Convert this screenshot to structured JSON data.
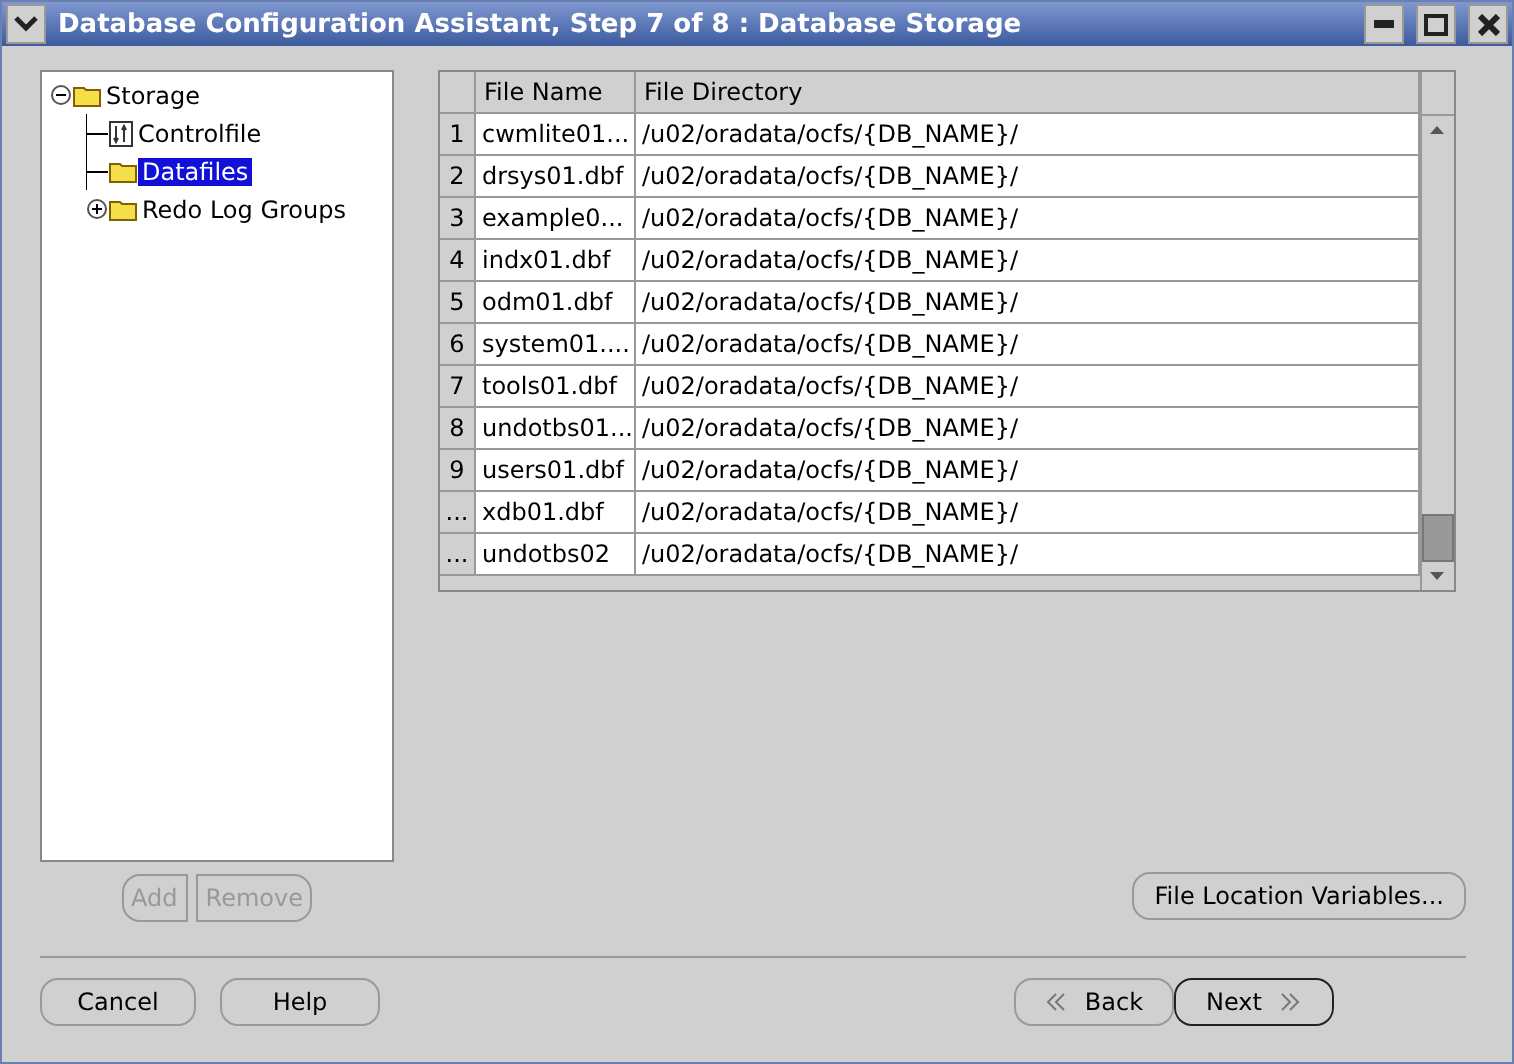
{
  "window": {
    "title": "Database Configuration Assistant, Step 7 of 8 : Database Storage"
  },
  "tree": [
    {
      "label": "Storage",
      "kind": "folder",
      "expanded": true,
      "selected": false,
      "children": [
        {
          "label": "Controlfile",
          "kind": "file",
          "selected": false
        },
        {
          "label": "Datafiles",
          "kind": "folder",
          "selected": true
        },
        {
          "label": "Redo Log Groups",
          "kind": "folder",
          "expanded": false,
          "selected": false
        }
      ]
    }
  ],
  "tree_buttons": [
    {
      "label": "Add",
      "disabled": true
    },
    {
      "label": "Remove",
      "disabled": true
    }
  ],
  "table": {
    "columns": [
      "File Name",
      "File Directory"
    ],
    "rows": [
      {
        "number": "1",
        "file_name": "cwmlite01...",
        "directory": "/u02/oradata/ocfs/{DB_NAME}/"
      },
      {
        "number": "2",
        "file_name": "drsys01.dbf",
        "directory": "/u02/oradata/ocfs/{DB_NAME}/"
      },
      {
        "number": "3",
        "file_name": "example0...",
        "directory": "/u02/oradata/ocfs/{DB_NAME}/"
      },
      {
        "number": "4",
        "file_name": "indx01.dbf",
        "directory": "/u02/oradata/ocfs/{DB_NAME}/"
      },
      {
        "number": "5",
        "file_name": "odm01.dbf",
        "directory": "/u02/oradata/ocfs/{DB_NAME}/"
      },
      {
        "number": "6",
        "file_name": "system01....",
        "directory": "/u02/oradata/ocfs/{DB_NAME}/"
      },
      {
        "number": "7",
        "file_name": "tools01.dbf",
        "directory": "/u02/oradata/ocfs/{DB_NAME}/"
      },
      {
        "number": "8",
        "file_name": "undotbs01...",
        "directory": "/u02/oradata/ocfs/{DB_NAME}/"
      },
      {
        "number": "9",
        "file_name": "users01.dbf",
        "directory": "/u02/oradata/ocfs/{DB_NAME}/"
      },
      {
        "number": "...",
        "file_name": "xdb01.dbf",
        "directory": "/u02/oradata/ocfs/{DB_NAME}/"
      },
      {
        "number": "...",
        "file_name": "undotbs02",
        "directory": "/u02/oradata/ocfs/{DB_NAME}/"
      }
    ]
  },
  "file_location_button": {
    "label": "File Location Variables..."
  },
  "footer_buttons": [
    {
      "label": "Cancel",
      "default": false
    },
    {
      "label": "Help",
      "default": false
    }
  ],
  "nav_buttons": [
    {
      "label": "Back",
      "kind": "back",
      "default": false
    },
    {
      "label": "Next",
      "kind": "next",
      "default": true
    }
  ]
}
